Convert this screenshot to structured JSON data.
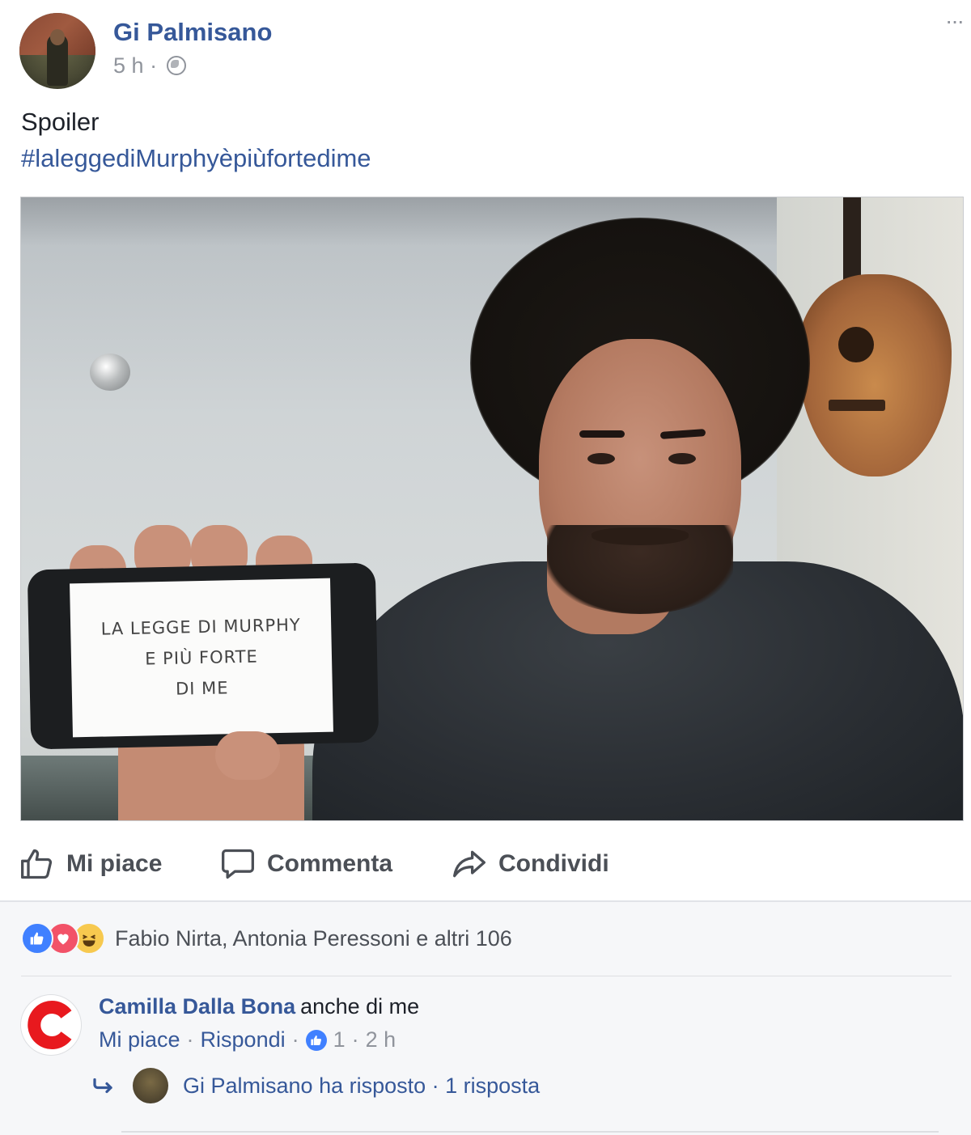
{
  "post": {
    "author": "Gi Palmisano",
    "timestamp": "5 h",
    "meta_separator": "·",
    "privacy_icon": "globe-icon",
    "more_label": "···",
    "text": "Spoiler",
    "hashtag": "#laleggediMurphyèpiùfortedime"
  },
  "photo": {
    "phone_screen_lines": [
      "LA LEGGE DI MURPHY",
      "E PIÙ FORTE",
      "DI ME"
    ]
  },
  "actions": {
    "like_label": "Mi piace",
    "comment_label": "Commenta",
    "share_label": "Condividi"
  },
  "reactions": {
    "icons": [
      "like-icon",
      "love-icon",
      "haha-icon"
    ],
    "summary": "Fabio Nirta, Antonia Peressoni e altri 106"
  },
  "comment": {
    "author": "Camilla Dalla Bona",
    "text": "anche di me",
    "like_label": "Mi piace",
    "reply_label": "Rispondi",
    "separator": "·",
    "like_count": "1",
    "time": "2 h",
    "reply_summary": "Gi Palmisano ha risposto · 1 risposta"
  },
  "colors": {
    "link_blue": "#365899",
    "text_grey": "#90949c",
    "like_blue": "#4080ff",
    "love_red": "#f25268",
    "haha_yellow": "#f7c94f",
    "avatar_red": "#e8191e"
  }
}
